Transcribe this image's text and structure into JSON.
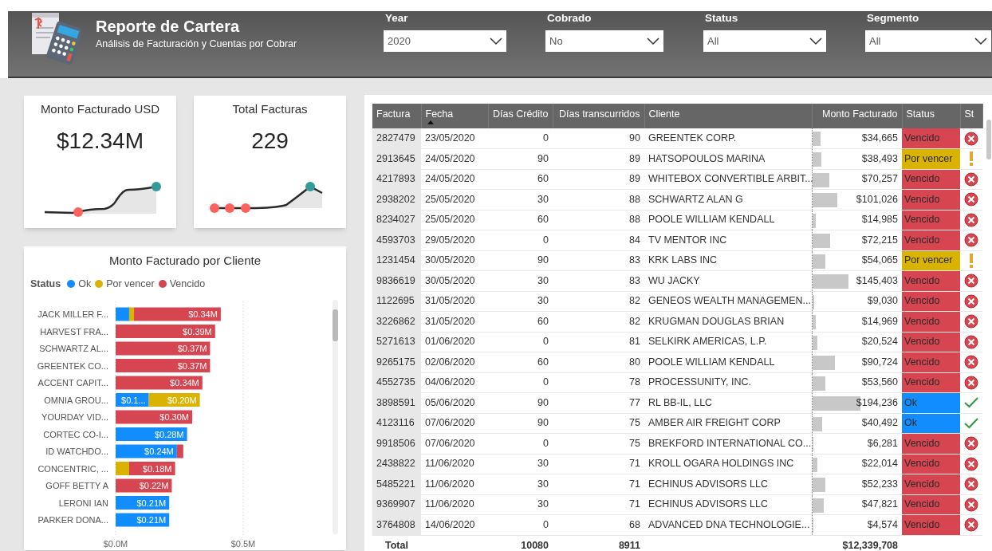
{
  "header": {
    "title": "Reporte de Cartera",
    "subtitle": "Análisis de Facturación y Cuentas por Cobrar"
  },
  "filters": [
    {
      "label": "Year",
      "value": "2020"
    },
    {
      "label": "Cobrado",
      "value": "No"
    },
    {
      "label": "Status",
      "value": "All"
    },
    {
      "label": "Segmento",
      "value": "All"
    }
  ],
  "kpis": [
    {
      "title": "Monto Facturado USD",
      "value": "$12.34M",
      "kind": "picture"
    },
    {
      "title": "Total Facturas",
      "value": "229",
      "kind": "picture"
    }
  ],
  "client_chart": {
    "chart_data": {
      "type": "bar",
      "orientation": "horizontal",
      "stacked": true,
      "title": "Monto Facturado por Cliente",
      "legend_title": "Status",
      "categories": [
        "JACK MILLER F...",
        "HARVEST FRA...",
        "SCHWARTZ AL...",
        "GREENTEK CO...",
        "ACCENT CAPIT...",
        "OMNIA GROU...",
        "YOURDAY VID...",
        "CORTEC CO-I...",
        "ID WATCHDO...",
        "CONCENTRIC, ...",
        "GOFF BETTY A",
        "LERONI IAN",
        "PARKER DONA..."
      ],
      "series": [
        {
          "name": "Ok",
          "color": "#118dff",
          "values": [
            0.053,
            null,
            null,
            null,
            null,
            0.13,
            null,
            0.28,
            0.24,
            null,
            null,
            0.21,
            0.21
          ]
        },
        {
          "name": "Por vencer",
          "color": "#d9b300",
          "values": [
            0.019,
            null,
            null,
            null,
            null,
            0.2,
            null,
            null,
            null,
            0.053,
            null,
            null,
            null
          ]
        },
        {
          "name": "Vencido",
          "color": "#d64550",
          "values": [
            0.34,
            0.39,
            0.37,
            0.37,
            0.34,
            null,
            0.3,
            null,
            0.025,
            0.18,
            0.22,
            null,
            null
          ]
        }
      ],
      "value_labels": [
        [
          null,
          null,
          null,
          null,
          null,
          "$0.1...",
          null,
          "$0.28M",
          "$0.24M",
          null,
          null,
          "$0.21M",
          "$0.21M"
        ],
        [
          null,
          null,
          null,
          null,
          null,
          "$0.20M",
          null,
          null,
          null,
          null,
          null,
          null,
          null
        ],
        [
          "$0.34M",
          "$0.39M",
          "$0.37M",
          "$0.37M",
          "$0.34M",
          null,
          "$0.30M",
          null,
          null,
          "$0.18M",
          "$0.22M",
          null,
          null
        ]
      ],
      "xlim": [
        0,
        0.5
      ],
      "xticks": [
        {
          "value": 0,
          "label": "$0.0M"
        },
        {
          "value": 0.5,
          "label": "$0.5M"
        }
      ]
    }
  },
  "table": {
    "columns": [
      {
        "label": "Factura",
        "sorted": false
      },
      {
        "label": "Fecha",
        "sorted": true
      },
      {
        "label": "Días Crédito",
        "sorted": false
      },
      {
        "label": "Días transcurridos",
        "sorted": false
      },
      {
        "label": "Cliente",
        "sorted": false
      },
      {
        "label": "Monto Facturado",
        "sorted": false
      },
      {
        "label": "Status",
        "sorted": false
      },
      {
        "label": "St",
        "sorted": false
      }
    ],
    "rows": [
      {
        "factura": "2827479",
        "fecha": "23/05/2020",
        "dias_credito": "0",
        "dias_transcurridos": "90",
        "cliente": "GREENTEK CORP.",
        "monto": "$34,665",
        "level": 0.098,
        "status": "Vencido",
        "kind": "vencido"
      },
      {
        "factura": "2913645",
        "fecha": "24/05/2020",
        "dias_credito": "90",
        "dias_transcurridos": "89",
        "cliente": "HATSOPOULOS MARINA",
        "monto": "$38,493",
        "level": 0.109,
        "status": "Por vencer",
        "kind": "por_vencer"
      },
      {
        "factura": "4217893",
        "fecha": "24/05/2020",
        "dias_credito": "60",
        "dias_transcurridos": "89",
        "cliente": "WHITEBOX CONVERTIBLE ARBIT...",
        "monto": "$70,257",
        "level": 0.199,
        "status": "Vencido",
        "kind": "vencido"
      },
      {
        "factura": "2938202",
        "fecha": "25/05/2020",
        "dias_credito": "30",
        "dias_transcurridos": "88",
        "cliente": "SCHWARTZ ALAN G",
        "monto": "$101,026",
        "level": 0.286,
        "status": "Vencido",
        "kind": "vencido"
      },
      {
        "factura": "8234027",
        "fecha": "25/05/2020",
        "dias_credito": "60",
        "dias_transcurridos": "88",
        "cliente": "POOLE WILLIAM KENDALL",
        "monto": "$14,985",
        "level": 0.042,
        "status": "Vencido",
        "kind": "vencido"
      },
      {
        "factura": "4593703",
        "fecha": "29/05/2020",
        "dias_credito": "0",
        "dias_transcurridos": "84",
        "cliente": "TV MENTOR INC",
        "monto": "$72,215",
        "level": 0.205,
        "status": "Vencido",
        "kind": "vencido"
      },
      {
        "factura": "1231454",
        "fecha": "30/05/2020",
        "dias_credito": "90",
        "dias_transcurridos": "83",
        "cliente": "KRK LABS INC",
        "monto": "$54,065",
        "level": 0.153,
        "status": "Por vencer",
        "kind": "por_vencer"
      },
      {
        "factura": "9836619",
        "fecha": "30/05/2020",
        "dias_credito": "30",
        "dias_transcurridos": "83",
        "cliente": "WU JACKY",
        "monto": "$145,403",
        "level": 0.412,
        "status": "Vencido",
        "kind": "vencido"
      },
      {
        "factura": "1122695",
        "fecha": "31/05/2020",
        "dias_credito": "30",
        "dias_transcurridos": "82",
        "cliente": "GENEOS WEALTH MANAGEMEN...",
        "monto": "$9,030",
        "level": 0.026,
        "status": "Vencido",
        "kind": "vencido"
      },
      {
        "factura": "3226862",
        "fecha": "31/05/2020",
        "dias_credito": "60",
        "dias_transcurridos": "82",
        "cliente": "KRUGMAN DOUGLAS BRIAN",
        "monto": "$14,969",
        "level": 0.042,
        "status": "Vencido",
        "kind": "vencido"
      },
      {
        "factura": "5271613",
        "fecha": "01/06/2020",
        "dias_credito": "0",
        "dias_transcurridos": "81",
        "cliente": "SELKIRK AMERICAS, L.P.",
        "monto": "$20,524",
        "level": 0.058,
        "status": "Vencido",
        "kind": "vencido"
      },
      {
        "factura": "9265175",
        "fecha": "02/06/2020",
        "dias_credito": "60",
        "dias_transcurridos": "80",
        "cliente": "POOLE WILLIAM KENDALL",
        "monto": "$90,724",
        "level": 0.257,
        "status": "Vencido",
        "kind": "vencido"
      },
      {
        "factura": "4552735",
        "fecha": "04/06/2020",
        "dias_credito": "0",
        "dias_transcurridos": "78",
        "cliente": "PROCESSUNITY, INC.",
        "monto": "$53,560",
        "level": 0.152,
        "status": "Vencido",
        "kind": "vencido"
      },
      {
        "factura": "3898591",
        "fecha": "05/06/2020",
        "dias_credito": "90",
        "dias_transcurridos": "77",
        "cliente": "RL BB-IL, LLC",
        "monto": "$194,236",
        "level": 0.55,
        "status": "Ok",
        "kind": "ok"
      },
      {
        "factura": "4123116",
        "fecha": "07/06/2020",
        "dias_credito": "90",
        "dias_transcurridos": "75",
        "cliente": "AMBER AIR FREIGHT CORP",
        "monto": "$40,492",
        "level": 0.115,
        "status": "Ok",
        "kind": "ok"
      },
      {
        "factura": "9918506",
        "fecha": "07/06/2020",
        "dias_credito": "0",
        "dias_transcurridos": "75",
        "cliente": "BREKFORD INTERNATIONAL CO...",
        "monto": "$6,281",
        "level": 0.018,
        "status": "Vencido",
        "kind": "vencido"
      },
      {
        "factura": "2438822",
        "fecha": "11/06/2020",
        "dias_credito": "30",
        "dias_transcurridos": "71",
        "cliente": "KROLL OGARA HOLDINGS INC",
        "monto": "$22,014",
        "level": 0.062,
        "status": "Vencido",
        "kind": "vencido"
      },
      {
        "factura": "5485221",
        "fecha": "11/06/2020",
        "dias_credito": "30",
        "dias_transcurridos": "71",
        "cliente": "ECHINUS ADVISORS LLC",
        "monto": "$52,233",
        "level": 0.148,
        "status": "Vencido",
        "kind": "vencido"
      },
      {
        "factura": "9369907",
        "fecha": "11/06/2020",
        "dias_credito": "30",
        "dias_transcurridos": "71",
        "cliente": "ECHINUS ADVISORS LLC",
        "monto": "$47,821",
        "level": 0.135,
        "status": "Vencido",
        "kind": "vencido"
      },
      {
        "factura": "3764808",
        "fecha": "14/06/2020",
        "dias_credito": "0",
        "dias_transcurridos": "68",
        "cliente": "ADVANCED DNA TECHNOLOGIE...",
        "monto": "$4,574",
        "level": 0.013,
        "status": "Vencido",
        "kind": "vencido"
      }
    ],
    "total": {
      "label": "Total",
      "dias_credito": "10080",
      "dias_transcurridos": "8911",
      "monto": "$12,339,708"
    }
  }
}
